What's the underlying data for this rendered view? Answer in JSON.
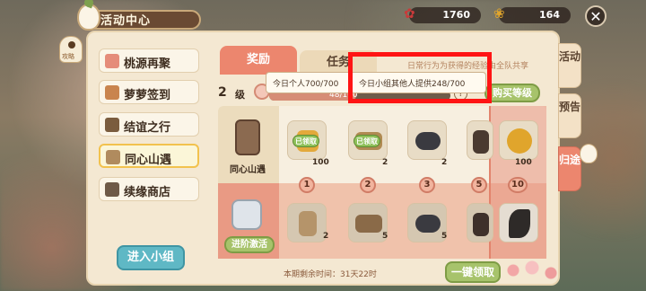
{
  "header": {
    "title": "活动中心",
    "currency": [
      {
        "icon": "flower-coin-icon",
        "value": "1760"
      },
      {
        "icon": "knot-coin-icon",
        "value": "164"
      }
    ],
    "close_glyph": "✕"
  },
  "left_badge": {
    "label": "攻略"
  },
  "sidebar": {
    "items": [
      {
        "label": "桃源再聚",
        "icon": "peach-icon",
        "active": false
      },
      {
        "label": "萝萝签到",
        "icon": "calendar-icon",
        "active": false
      },
      {
        "label": "结谊之行",
        "icon": "book-icon",
        "active": false
      },
      {
        "label": "同心山遇",
        "icon": "scroll-icon",
        "active": true
      },
      {
        "label": "续缘商店",
        "icon": "shop-icon",
        "active": false
      }
    ],
    "enter_button": "进入小组"
  },
  "tabs": [
    {
      "label": "奖励",
      "active": true
    },
    {
      "label": "任务",
      "active": false
    }
  ],
  "info_text": "日常行为为获得的经验由全队共享",
  "level": {
    "number": "2",
    "unit": "级",
    "progress_text": "48/100",
    "progress": 0.48,
    "help": "?",
    "buy_button": "购买等级"
  },
  "tooltip": {
    "personal": "今日个人700/700",
    "group": "今日小组其他人提供248/700"
  },
  "rows": {
    "basic_label": "同心山遇",
    "advanced_button": "进阶激活"
  },
  "rewards": {
    "basic": [
      {
        "level": "1",
        "qty": "100",
        "claimed": true,
        "icon": "coin-bag-icon"
      },
      {
        "level": "2",
        "qty": "2",
        "claimed": true,
        "icon": "box-icon"
      },
      {
        "level": "3",
        "qty": "2",
        "claimed": false,
        "icon": "ore-icon"
      },
      {
        "level": "5",
        "qty": "",
        "claimed": false,
        "icon": "jar-icon"
      },
      {
        "level": "10",
        "qty": "100",
        "claimed": false,
        "icon": "knot-icon"
      }
    ],
    "advanced": [
      {
        "qty": "2",
        "icon": "jar-icon"
      },
      {
        "qty": "5",
        "icon": "box-icon"
      },
      {
        "qty": "5",
        "icon": "ore-icon"
      },
      {
        "qty": "",
        "icon": "jar-icon"
      },
      {
        "qty": "",
        "icon": "feather-icon"
      }
    ],
    "claimed_label": "已领取"
  },
  "footer": {
    "remaining": "本期剩余时间：31天22时",
    "claim_all": "一键领取"
  },
  "right_tabs": [
    {
      "label": "活动",
      "active": false
    },
    {
      "label": "预告",
      "active": false
    },
    {
      "label": "归途",
      "active": true
    }
  ],
  "colors": {
    "accent": "#ec866e",
    "green": "#a7c36b",
    "panel": "#f4e8d2",
    "highlight": "#ff1414"
  }
}
